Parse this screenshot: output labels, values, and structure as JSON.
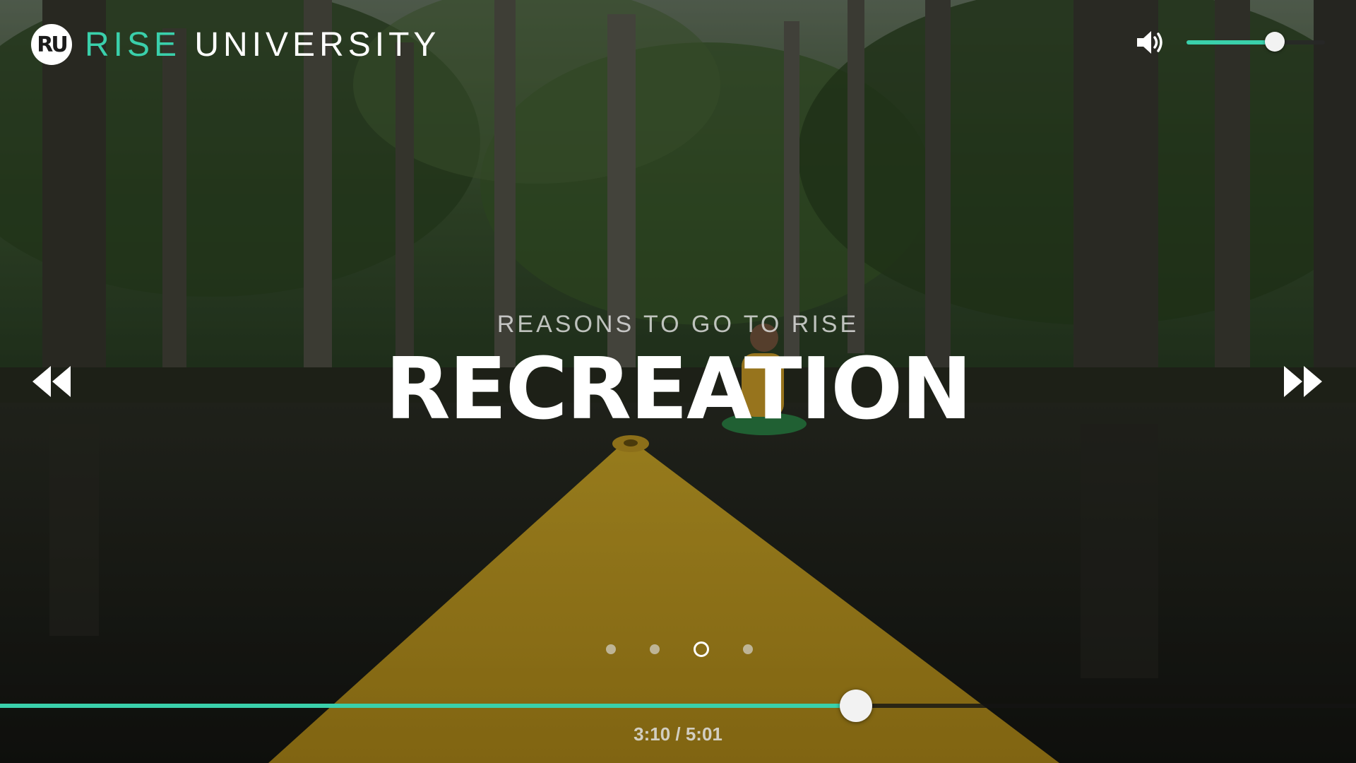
{
  "brand": {
    "logo_mark": "RU",
    "name_accent": "RISE",
    "name_rest": "UNIVERSITY",
    "accent_color": "#3ad0ab"
  },
  "volume": {
    "icon": "speaker-volume-icon",
    "level": 0.64
  },
  "slide": {
    "eyebrow": "REASONS TO GO TO RISE",
    "title": "RECREATION",
    "current_index": 3,
    "total": 4
  },
  "navigation": {
    "previous_icon": "rewind-icon",
    "next_icon": "fast-forward-icon"
  },
  "playback": {
    "current_time": "3:10",
    "duration": "5:01",
    "time_display": "3:10 / 5:01",
    "progress": 0.631
  }
}
